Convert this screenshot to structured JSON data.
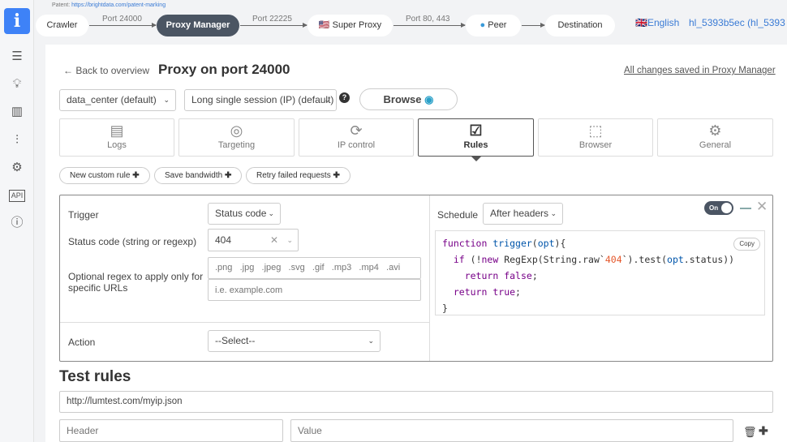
{
  "patent": {
    "label": "Patent:",
    "url": "https://brightdata.com/patent-marking"
  },
  "flow": {
    "nodes": [
      "Crawler",
      "Proxy Manager",
      "Super Proxy",
      "Peer",
      "Destination"
    ],
    "ports": [
      "Port 24000",
      "Port 22225",
      "Port 80, 443"
    ]
  },
  "header": {
    "language": "English",
    "account": "hl_5393b5ec (hl_5393"
  },
  "page": {
    "back": "Back to overview",
    "title": "Proxy on port 24000",
    "saved": "All changes saved in Proxy Manager"
  },
  "zone": {
    "value": "data_center (default)"
  },
  "session": {
    "value": "Long single session (IP) (default)"
  },
  "browse": "Browse",
  "tabs": [
    {
      "label": "Logs",
      "icon": "logs-icon"
    },
    {
      "label": "Targeting",
      "icon": "target-icon"
    },
    {
      "label": "IP control",
      "icon": "refresh-icon"
    },
    {
      "label": "Rules",
      "icon": "rules-icon",
      "active": true
    },
    {
      "label": "Browser",
      "icon": "browser-icon"
    },
    {
      "label": "General",
      "icon": "gear-icon"
    }
  ],
  "presets": [
    "New custom rule",
    "Save bandwidth",
    "Retry failed requests"
  ],
  "rule": {
    "trigger_label": "Trigger",
    "trigger_value": "Status code",
    "status_label": "Status code (string or regexp)",
    "status_value": "404",
    "regex_label": "Optional regex to apply only for specific URLs",
    "extensions": [
      ".png",
      ".jpg",
      ".jpeg",
      ".svg",
      ".gif",
      ".mp3",
      ".mp4",
      ".avi"
    ],
    "url_placeholder": "i.e. example.com",
    "action_label": "Action",
    "action_value": "--Select--",
    "schedule_label": "Schedule",
    "schedule_value": "After headers",
    "toggle": "On",
    "copy": "Copy",
    "code": {
      "l1a": "function",
      "l1b": "trigger",
      "l1c": "(",
      "l1d": "opt",
      "l1e": "){",
      "l2a": "if",
      "l2b": " (!",
      "l2c": "new",
      "l2d": " RegExp(String.raw`",
      "l2e": "404",
      "l2f": "`).test(",
      "l2g": "opt",
      "l2h": ".status))",
      "l3a": "return",
      "l3b": "false",
      "l3c": ";",
      "l4a": "return",
      "l4b": "true",
      "l4c": ";",
      "l5": "}"
    }
  },
  "test": {
    "title": "Test rules",
    "url": "http://lumtest.com/myip.json",
    "header_placeholder": "Header",
    "value_placeholder": "Value"
  }
}
